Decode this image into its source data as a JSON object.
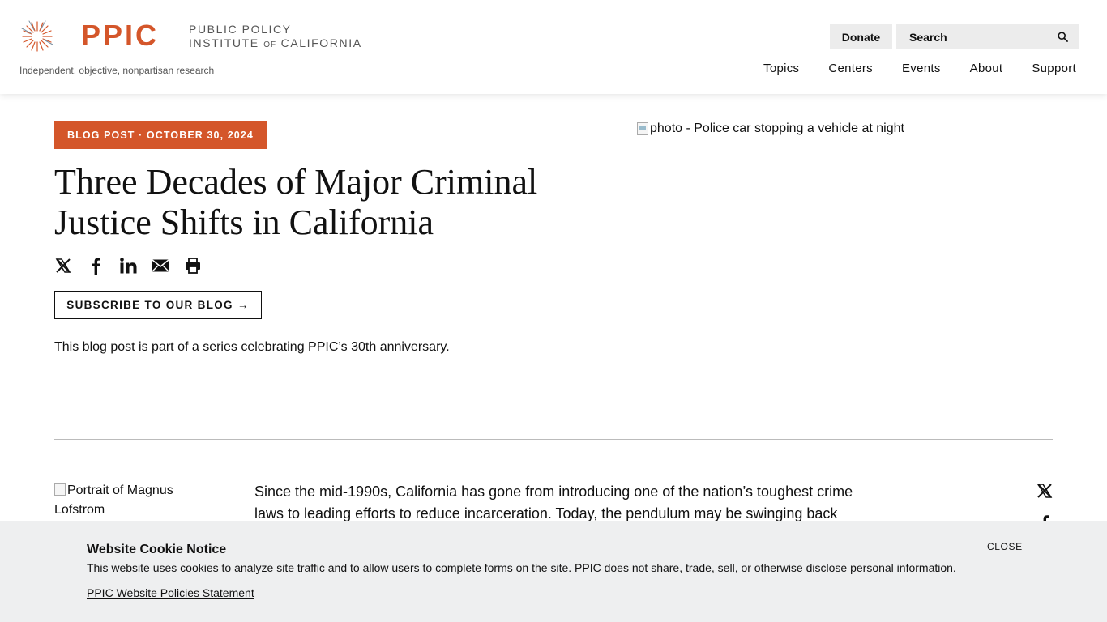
{
  "header": {
    "logo_text": "PPIC",
    "logo_name_line1": "PUBLIC POLICY",
    "logo_name_line2_a": "INSTITUTE ",
    "logo_name_line2_of": "OF",
    "logo_name_line2_b": " CALIFORNIA",
    "tagline": "Independent, objective, nonpartisan research",
    "donate_label": "Donate",
    "search_placeholder": "Search",
    "nav": [
      "Topics",
      "Centers",
      "Events",
      "About",
      "Support"
    ]
  },
  "hero": {
    "badge": "BLOG POST · OCTOBER 30, 2024",
    "title": "Three Decades of Major Criminal Justice Shifts in California",
    "subscribe_label": "SUBSCRIBE TO OUR BLOG →",
    "series_note": "This blog post is part of a series celebrating PPIC’s 30th anniversary.",
    "image_alt": "photo - Police car stopping a vehicle at night"
  },
  "body": {
    "portrait_alt": "Portrait of Magnus Lofstrom",
    "article_text": "Since the mid-1990s, California has gone from introducing one of the nation’s toughest crime laws to leading efforts to reduce incarceration. Today, the pendulum may be swinging back"
  },
  "cookie": {
    "title": "Website Cookie Notice",
    "text": "This website uses cookies to analyze site traffic and to allow users to complete forms on the site. PPIC does not share, trade, sell, or otherwise disclose personal information.",
    "link": "PPIC Website Policies Statement",
    "close_label": "CLOSE"
  },
  "colors": {
    "brand_orange": "#d4562a",
    "cookie_bg": "#eeeff0",
    "button_bg": "#ececec"
  },
  "icons": {
    "share": [
      "x-icon",
      "facebook-icon",
      "linkedin-icon",
      "email-icon",
      "print-icon"
    ],
    "search": "search-icon",
    "logo": "sunburst-logo-icon"
  }
}
